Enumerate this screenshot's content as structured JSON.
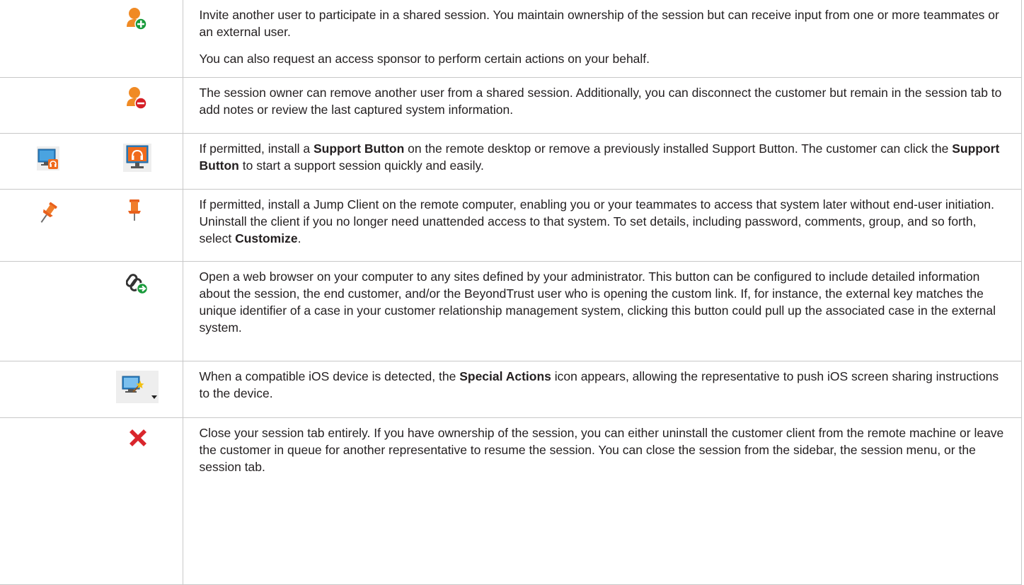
{
  "rows": [
    {
      "icons": [
        "invite-user-icon"
      ],
      "paragraphs": [
        [
          "Invite another user to participate in a shared session. You maintain ownership of the session but can receive input from one or more teammates or an external user."
        ],
        [
          "You can also request an access sponsor to perform certain actions on your behalf."
        ]
      ]
    },
    {
      "icons": [
        "remove-user-icon"
      ],
      "paragraphs": [
        [
          "The session owner can remove another user from a shared session. Additionally, you can disconnect the customer but remain in the session tab to add notes or review the last captured system information."
        ]
      ]
    },
    {
      "icons": [
        "install-support-button-icon",
        "remove-support-button-icon"
      ],
      "paragraphs": [
        [
          "If permitted, install a ",
          "Support Button",
          " on the remote desktop or remove a previously installed Support Button. The customer can click the ",
          "Support Button",
          " to start a support session quickly and easily."
        ]
      ]
    },
    {
      "icons": [
        "pin-jump-client-icon",
        "unpin-jump-client-icon"
      ],
      "paragraphs": [
        [
          "If permitted, install a Jump Client on the remote computer, enabling you or your teammates to access that system later without end-user initiation. Uninstall the client if you no longer need unattended access to that system. To set details, including password, comments, group, and so forth, select ",
          "Customize",
          "."
        ]
      ]
    },
    {
      "icons": [
        "custom-link-icon"
      ],
      "paragraphs": [
        [
          "Open a web browser on your computer to any sites defined by your administrator. This button can be configured to include detailed information about the session, the end customer, and/or the BeyondTrust user who is opening the custom link. If, for instance, the external key matches the unique identifier of a case in your customer relationship management system, clicking this button could pull up the associated case in the external system."
        ]
      ]
    },
    {
      "icons": [
        "special-actions-icon"
      ],
      "paragraphs": [
        [
          "When a compatible iOS device is detected, the ",
          "Special Actions",
          " icon appears, allowing the representative to push iOS screen sharing instructions to the device."
        ]
      ]
    },
    {
      "icons": [
        "close-session-icon"
      ],
      "paragraphs": [
        [
          "Close your session tab entirely. If you have ownership of the session, you can either uninstall the customer client from the remote machine or leave the customer in queue for another representative to resume the session. You can close the session from the sidebar, the session menu, or the session tab."
        ]
      ]
    }
  ],
  "colors": {
    "user_orange": "#f08a24",
    "add_green": "#1a9b3c",
    "remove_red": "#d51f26",
    "monitor_blue": "#2a7fc1",
    "close_red": "#d9262c",
    "border": "#c8c8c8",
    "text": "#231f20"
  }
}
